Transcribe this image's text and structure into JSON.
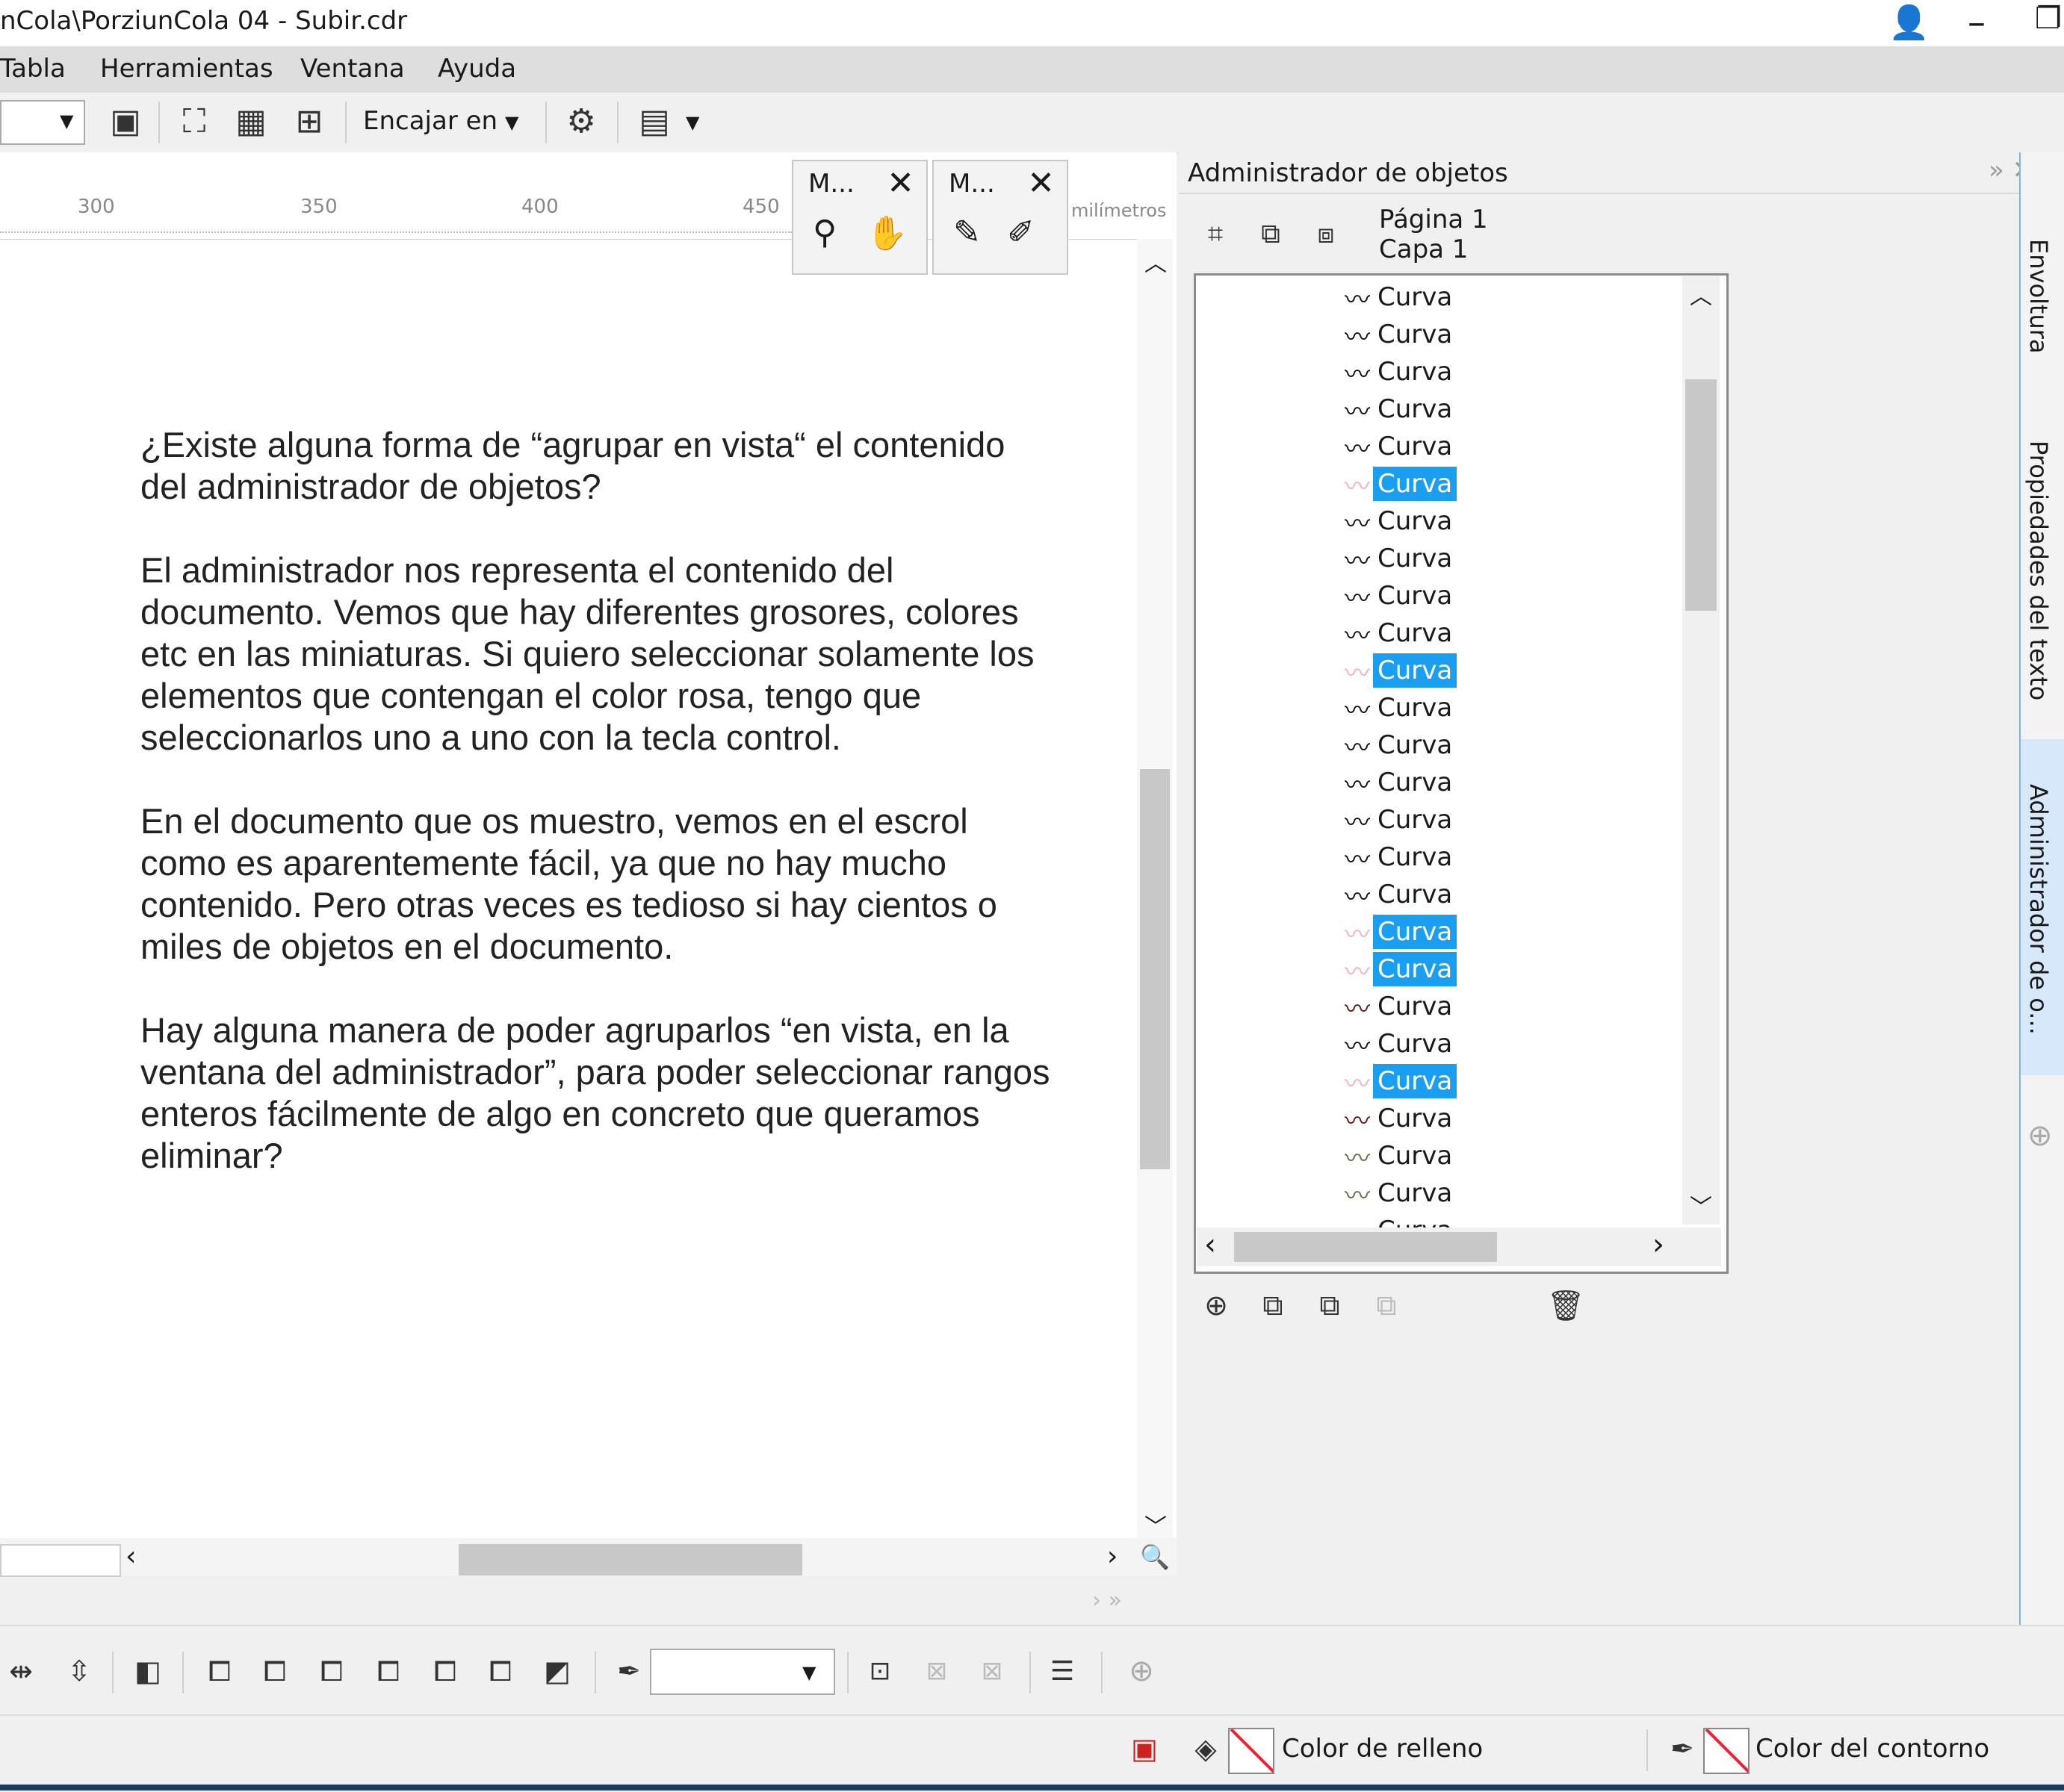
{
  "window": {
    "title": "nCola\\PorziunCola 04 - Subir.cdr"
  },
  "menu": [
    "Tabla",
    "Herramientas",
    "Ventana",
    "Ayuda"
  ],
  "toolbar": {
    "snap_label": "Encajar en"
  },
  "ruler": {
    "ticks": [
      "300",
      "350",
      "400",
      "450"
    ],
    "unit": "milímetros"
  },
  "mini_toolbars": [
    {
      "title": "M...",
      "close": "✕"
    },
    {
      "title": "M...",
      "close": "✕"
    }
  ],
  "question": {
    "paragraphs": [
      "¿Existe alguna forma de “agrupar en vista“ el contenido del administrador de objetos?",
      "El administrador nos representa el contenido del documento. Vemos que hay diferentes grosores, colores etc en las miniaturas. Si quiero seleccionar solamente los elementos que contengan el color rosa, tengo que seleccionarlos uno a uno con la tecla control.",
      "En el documento que os muestro, vemos en el escrol como es aparentemente fácil, ya que no hay mucho contenido. Pero otras veces es tedioso si hay cientos o miles de objetos en el documento.",
      "Hay alguna manera de poder agruparlos “en vista, en la ventana del administrador”, para poder seleccionar rangos enteros fácilmente de algo en concreto que queramos eliminar?"
    ]
  },
  "object_manager": {
    "title": "Administrador de objetos",
    "page": "Página 1",
    "layer": "Capa 1",
    "items": [
      {
        "label": "Curva",
        "color": "#111111",
        "selected": false
      },
      {
        "label": "Curva",
        "color": "#111111",
        "selected": false
      },
      {
        "label": "Curva",
        "color": "#111111",
        "selected": false
      },
      {
        "label": "Curva",
        "color": "#111111",
        "selected": false
      },
      {
        "label": "Curva",
        "color": "#111111",
        "selected": false
      },
      {
        "label": "Curva",
        "color": "#f2b3c0",
        "selected": true
      },
      {
        "label": "Curva",
        "color": "#111111",
        "selected": false
      },
      {
        "label": "Curva",
        "color": "#111111",
        "selected": false
      },
      {
        "label": "Curva",
        "color": "#111111",
        "selected": false
      },
      {
        "label": "Curva",
        "color": "#111111",
        "selected": false
      },
      {
        "label": "Curva",
        "color": "#f2b3c0",
        "selected": true
      },
      {
        "label": "Curva",
        "color": "#111111",
        "selected": false
      },
      {
        "label": "Curva",
        "color": "#111111",
        "selected": false
      },
      {
        "label": "Curva",
        "color": "#111111",
        "selected": false
      },
      {
        "label": "Curva",
        "color": "#111111",
        "selected": false
      },
      {
        "label": "Curva",
        "color": "#111111",
        "selected": false
      },
      {
        "label": "Curva",
        "color": "#111111",
        "selected": false
      },
      {
        "label": "Curva",
        "color": "#f2b3c0",
        "selected": true
      },
      {
        "label": "Curva",
        "color": "#f2b3c0",
        "selected": true
      },
      {
        "label": "Curva",
        "color": "#5a1a1a",
        "selected": false
      },
      {
        "label": "Curva",
        "color": "#111111",
        "selected": false
      },
      {
        "label": "Curva",
        "color": "#f2b3c0",
        "selected": true
      },
      {
        "label": "Curva",
        "color": "#5a1a1a",
        "selected": false
      },
      {
        "label": "Curva",
        "color": "#6b6b4a",
        "selected": false
      },
      {
        "label": "Curva",
        "color": "#6b6b4a",
        "selected": false
      },
      {
        "label": "Curva",
        "color": "#111111",
        "selected": false
      }
    ]
  },
  "dock_tabs": [
    "Envoltura",
    "Propiedades del texto",
    "Administrador de o..."
  ],
  "status": {
    "fill_label": "Color de relleno",
    "outline_label": "Color del contorno"
  },
  "colors": {
    "selection": "#1a9ff0",
    "pink_curve": "#f2b3c0"
  }
}
